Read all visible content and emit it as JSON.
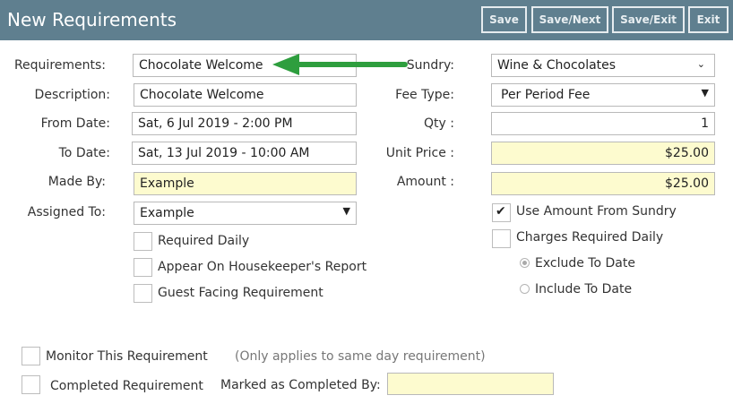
{
  "header": {
    "title": "New Requirements",
    "buttons": {
      "save": "Save",
      "save_next": "Save/Next",
      "save_exit": "Save/Exit",
      "exit": "Exit"
    }
  },
  "form": {
    "requirements": {
      "label": "Requirements:",
      "value": "Chocolate Welcome"
    },
    "description": {
      "label": "Description:",
      "value": "Chocolate Welcome"
    },
    "from_date": {
      "label": "From Date:",
      "value": "Sat, 6 Jul 2019 - 2:00 PM"
    },
    "to_date": {
      "label": "To Date:",
      "value": "Sat, 13 Jul 2019 - 10:00 AM"
    },
    "made_by": {
      "label": "Made By:",
      "value": "Example"
    },
    "assigned_to": {
      "label": "Assigned To:",
      "value": "Example"
    },
    "sundry": {
      "label": "Sundry:",
      "value": "Wine & Chocolates"
    },
    "fee_type": {
      "label": "Fee Type:",
      "value": "Per Period Fee"
    },
    "qty": {
      "label": "Qty :",
      "value": "1"
    },
    "unit_price": {
      "label": "Unit Price :",
      "value": "$25.00"
    },
    "amount": {
      "label": "Amount :",
      "value": "$25.00"
    }
  },
  "checkboxes": {
    "required_daily": {
      "label": "Required Daily",
      "checked": false
    },
    "housekeeper_report": {
      "label": "Appear On Housekeeper's Report",
      "checked": false
    },
    "guest_facing": {
      "label": "Guest Facing Requirement",
      "checked": false
    },
    "use_amount_from_sundry": {
      "label": "Use Amount From Sundry",
      "checked": true
    },
    "charges_required_daily": {
      "label": "Charges Required Daily",
      "checked": false
    },
    "monitor_requirement": {
      "label": "Monitor This Requirement",
      "checked": false
    },
    "completed_requirement": {
      "label": "Completed Requirement",
      "checked": false
    }
  },
  "radios": {
    "exclude_to_date": {
      "label": "Exclude To Date",
      "selected": true
    },
    "include_to_date": {
      "label": "Include To Date",
      "selected": false
    }
  },
  "monitor_note": "(Only applies to same day requirement)",
  "marked_completed_by": {
    "label": "Marked as Completed By:",
    "value": ""
  },
  "colors": {
    "header_bg": "#5f7f8f",
    "highlight_field": "#fdfbcf",
    "arrow": "#2e9e3e"
  },
  "icons": {
    "dropdown": "chevron-down-icon",
    "arrow": "green-arrow-pointer"
  }
}
